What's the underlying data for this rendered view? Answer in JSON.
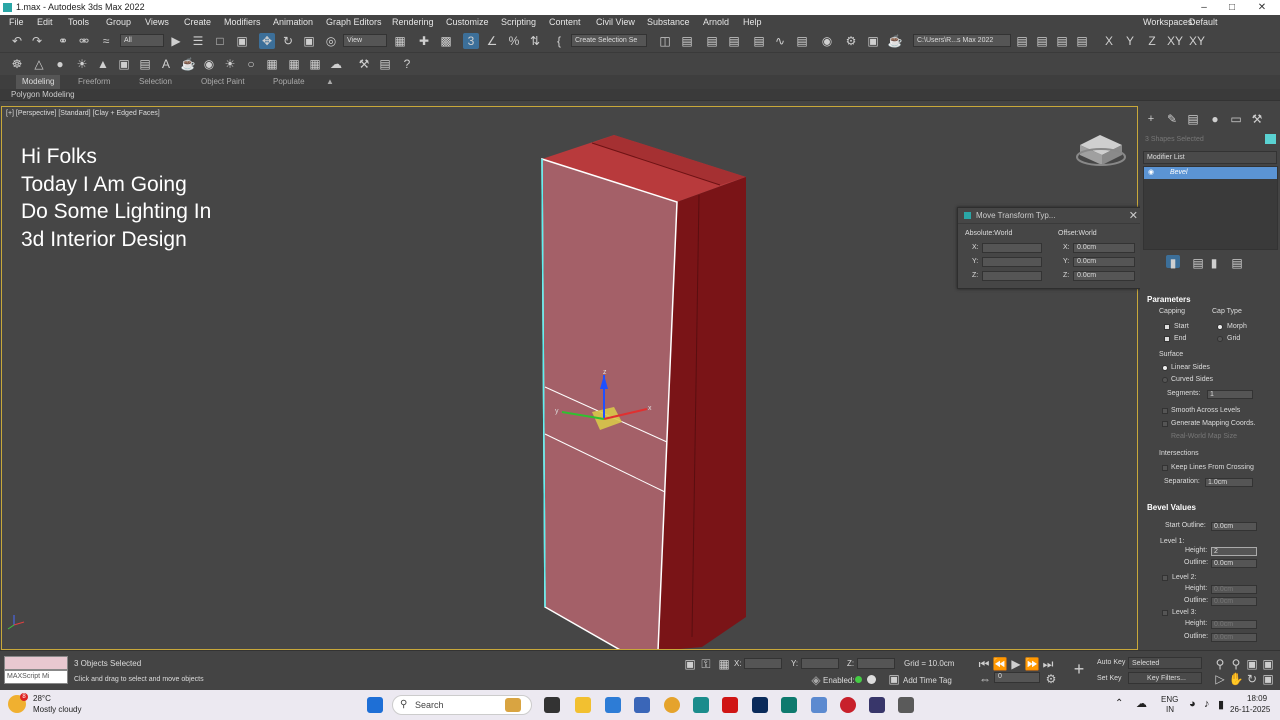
{
  "window": {
    "title": "1.max - Autodesk 3ds Max 2022",
    "workspace_label": "Workspaces:",
    "workspace_value": "Default"
  },
  "menu": [
    "File",
    "Edit",
    "Tools",
    "Group",
    "Views",
    "Create",
    "Modifiers",
    "Animation",
    "Graph Editors",
    "Rendering",
    "Customize",
    "Scripting",
    "Content",
    "Civil View",
    "Substance",
    "Arnold",
    "Help"
  ],
  "toolbar": {
    "filter_value": "All",
    "view_value": "View",
    "selection_set": "Create Selection Se",
    "path_value": "C:\\Users\\R...s Max 2022",
    "axis_labels": [
      "X",
      "Y",
      "Z",
      "XY",
      "XY"
    ]
  },
  "ribbon": {
    "tabs": [
      "Modeling",
      "Freeform",
      "Selection",
      "Object Paint",
      "Populate"
    ],
    "sub": "Polygon Modeling"
  },
  "viewport": {
    "label": "[+] [Perspective] [Standard] [Clay + Edged Faces]",
    "intro_lines": [
      "Hi Folks",
      "Today I Am Going",
      "Do Some Lighting In",
      "3d Interior Design"
    ]
  },
  "move_dialog": {
    "title": "Move Transform Typ...",
    "absolute": "Absolute:World",
    "offset": "Offset:World",
    "rows": [
      {
        "axis": "X:",
        "abs": "",
        "off": "0.0cm"
      },
      {
        "axis": "Y:",
        "abs": "",
        "off": "0.0cm"
      },
      {
        "axis": "Z:",
        "abs": "",
        "off": "0.0cm"
      }
    ]
  },
  "command_panel": {
    "selection_info": "3 Shapes Selected",
    "modifier_list": "Modifier List",
    "modifier": "Bevel",
    "parameters": "Parameters",
    "capping": "Capping",
    "cap_type": "Cap Type",
    "cap_start": "Start",
    "cap_end": "End",
    "morph": "Morph",
    "grid": "Grid",
    "surface": "Surface",
    "linear_sides": "Linear Sides",
    "curved_sides": "Curved Sides",
    "segments_label": "Segments:",
    "segments_value": "1",
    "smooth_across": "Smooth Across Levels",
    "gen_mapping": "Generate Mapping Coords.",
    "real_world": "Real-World Map Size",
    "intersections": "Intersections",
    "keep_lines": "Keep Lines From Crossing",
    "separation_label": "Separation:",
    "separation_value": "1.0cm",
    "bevel_values": "Bevel Values",
    "start_outline_label": "Start Outline:",
    "start_outline_value": "0.0cm",
    "level1": "Level 1:",
    "height_label": "Height:",
    "level1_height": "2",
    "outline_label": "Outline:",
    "level1_outline": "0.0cm",
    "level2": "Level 2:",
    "level2_height": "0.0cm",
    "level2_outline": "0.0cm",
    "level3": "Level 3:",
    "level3_height": "0.0cm",
    "level3_outline": "0.0cm"
  },
  "status": {
    "maxscript": "MAXScript Mi",
    "selected": "3 Objects Selected",
    "hint": "Click and drag to select and move objects",
    "x_label": "X:",
    "y_label": "Y:",
    "z_label": "Z:",
    "grid": "Grid = 10.0cm",
    "enabled": "Enabled:",
    "add_time_tag": "Add Time Tag",
    "auto_key": "Auto Key",
    "selected_dd": "Selected",
    "set_key": "Set Key",
    "key_filters": "Key Filters...",
    "frame": "0"
  },
  "taskbar": {
    "weather_temp": "28°C",
    "weather_desc": "Mostly cloudy",
    "search": "Search",
    "lang1": "ENG",
    "lang2": "IN",
    "time": "18:09",
    "date": "26-11-2025"
  }
}
